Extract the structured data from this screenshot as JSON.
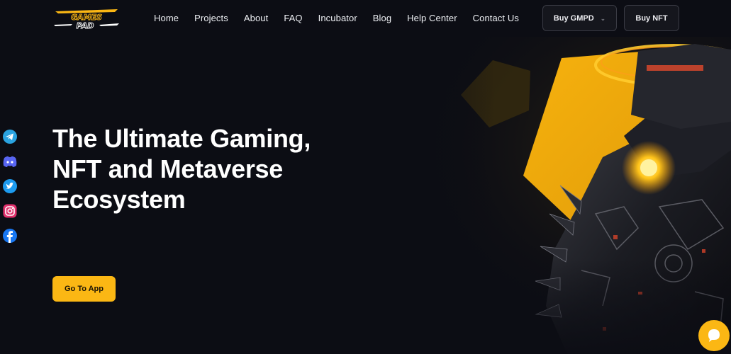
{
  "header": {
    "logo_alt": "GAMES PAD",
    "logo_line1": "GAMES",
    "logo_line2": "PAD",
    "nav": [
      {
        "label": "Home"
      },
      {
        "label": "Projects"
      },
      {
        "label": "About"
      },
      {
        "label": "FAQ"
      },
      {
        "label": "Incubator"
      },
      {
        "label": "Blog"
      },
      {
        "label": "Help Center"
      },
      {
        "label": "Contact Us"
      }
    ],
    "buy_gmpd_label": "Buy GMPD",
    "buy_nft_label": "Buy NFT"
  },
  "hero": {
    "title_lines": [
      "The Ultimate Gaming,",
      "NFT and Metaverse",
      "Ecosystem"
    ],
    "cta_label": "Go To App"
  },
  "socials": [
    {
      "name": "telegram-icon",
      "color": "#2aa3e0"
    },
    {
      "name": "discord-icon",
      "color": "#5865f2"
    },
    {
      "name": "twitter-icon",
      "color": "#1d9bf0"
    },
    {
      "name": "instagram-icon",
      "color": "#e1306c"
    },
    {
      "name": "facebook-icon",
      "color": "#1877f2"
    }
  ],
  "colors": {
    "accent": "#fbb714",
    "background": "#0c0d14",
    "button_border": "#3a3b44"
  }
}
